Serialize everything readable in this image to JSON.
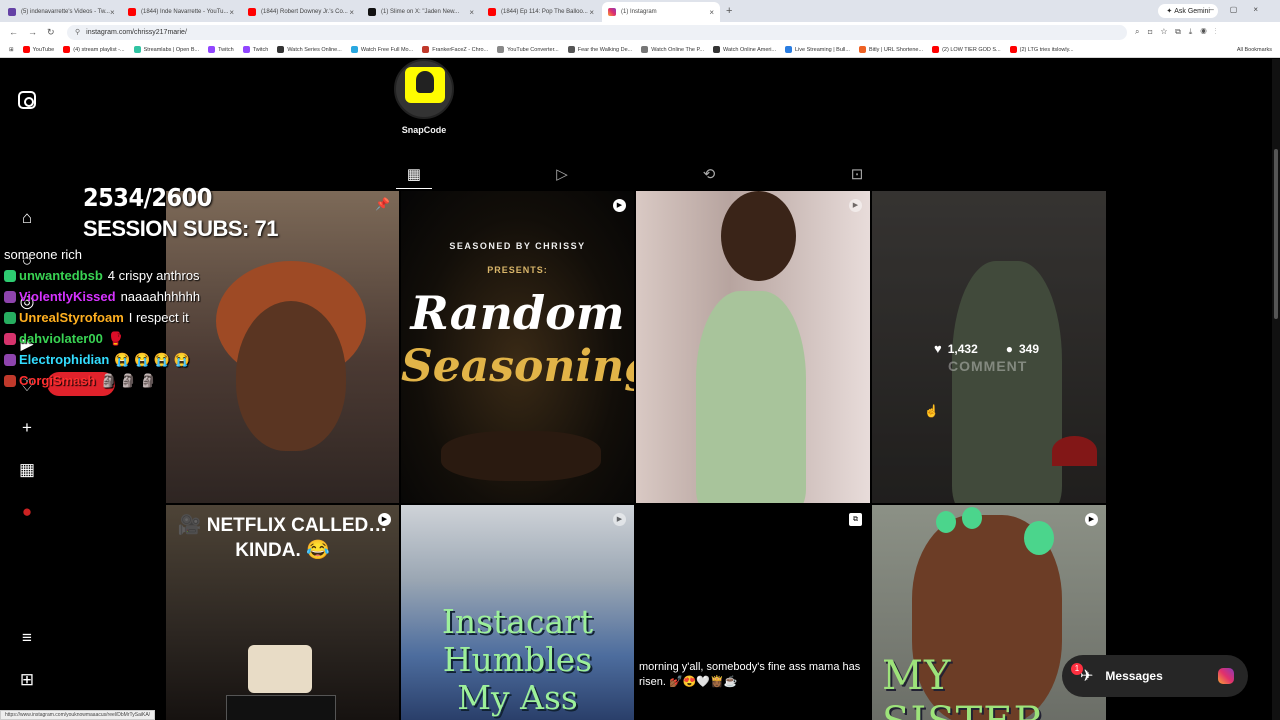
{
  "browser": {
    "tabs": [
      {
        "title": "(5) indenavarrette's Videos - Tw...",
        "color": "#6441a5"
      },
      {
        "title": "(1844) Inde Navarrette - YouTu...",
        "color": "#ff0000"
      },
      {
        "title": "(1844) Robert Downey Jr.'s Co...",
        "color": "#ff0000"
      },
      {
        "title": "(1) Slime on X: \"Jaden New...",
        "color": "#111111"
      },
      {
        "title": "(1844) Ep 114: Pop The Balloo...",
        "color": "#ff0000"
      },
      {
        "title": "(1) Instagram",
        "color": "#e1306c",
        "active": true
      }
    ],
    "ask_gemini": "Ask Gemini",
    "url": "instagram.com/chrissy217marie/",
    "bookmarks": [
      {
        "label": "YouTube",
        "color": "#ff0000"
      },
      {
        "label": "(4) stream playlist -...",
        "color": "#ff0000"
      },
      {
        "label": "Streamlabs | Open B...",
        "color": "#31c3a2"
      },
      {
        "label": "Twitch",
        "color": "#9146ff"
      },
      {
        "label": "Twitch",
        "color": "#9146ff"
      },
      {
        "label": "Watch Series Online...",
        "color": "#333333"
      },
      {
        "label": "Watch Free Full Mo...",
        "color": "#2aa8e0"
      },
      {
        "label": "FrankerFaceZ - Chro...",
        "color": "#c0392b"
      },
      {
        "label": "YouTube Converter...",
        "color": "#888888"
      },
      {
        "label": "Fear the Walking De...",
        "color": "#555555"
      },
      {
        "label": "Watch Online The P...",
        "color": "#777777"
      },
      {
        "label": "Watch Online Ameri...",
        "color": "#333333"
      },
      {
        "label": "Live Streaming | Bull...",
        "color": "#2a7de1"
      },
      {
        "label": "Bitly | URL Shortene...",
        "color": "#ee6123"
      },
      {
        "label": "(2) LOW TIER GOD S...",
        "color": "#ff0000"
      },
      {
        "label": "(2) LTG tries itslowly...",
        "color": "#ff0000"
      }
    ],
    "all_bookmarks": "All Bookmarks",
    "status_url": "https://www.instagram.com/youknowmaaacus/reel/DbMrTySaiKA/"
  },
  "profile": {
    "snapcode_label": "SnapCode"
  },
  "posts": [
    {
      "id": "p1",
      "pinned": true
    },
    {
      "id": "p2",
      "line1": "SEASONED BY CHRISSY",
      "line2": "PRESENTS:",
      "title1": "Random",
      "title2": "Seasoning"
    },
    {
      "id": "p3"
    },
    {
      "id": "p4",
      "likes": "1,432",
      "comments": "349",
      "hover_text": "COMMENT"
    },
    {
      "id": "p5",
      "caption": "🎥 NETFLIX CALLED…\nKINDA. 😂"
    },
    {
      "id": "p6",
      "caption": "Instacart Humbles\nMy Ass everyday!"
    },
    {
      "id": "p7",
      "caption": "morning y'all, somebody's fine ass mama has risen. 💅🏾😍🤍👸🏾☕"
    },
    {
      "id": "p8",
      "caption": "MY SISTER"
    }
  ],
  "messages": {
    "label": "Messages",
    "unread": "1"
  },
  "stream_overlay": {
    "counter": "2534/2600",
    "session_subs": "SESSION SUBS: 71",
    "chat": [
      {
        "user": "",
        "message": "someone rich",
        "color": "#ffffff"
      },
      {
        "user": "unwantedbsb",
        "message": "4 crispy anthros",
        "color": "#39d353"
      },
      {
        "user": "ViolentlyKissed",
        "message": "naaaahhhhhh",
        "color": "#d633ff"
      },
      {
        "user": "UnrealStyrofoam",
        "message": "I respect it",
        "color": "#ffb020"
      },
      {
        "user": "dahviolater00",
        "message": "🥊",
        "color": "#39d353"
      },
      {
        "user": "Electrophidian",
        "message": "😭 😭 😭 😭",
        "color": "#33ddff"
      },
      {
        "user": "CorgiSmash",
        "message": "🗿 🗿 🗿",
        "color": "#ff3030"
      }
    ]
  }
}
